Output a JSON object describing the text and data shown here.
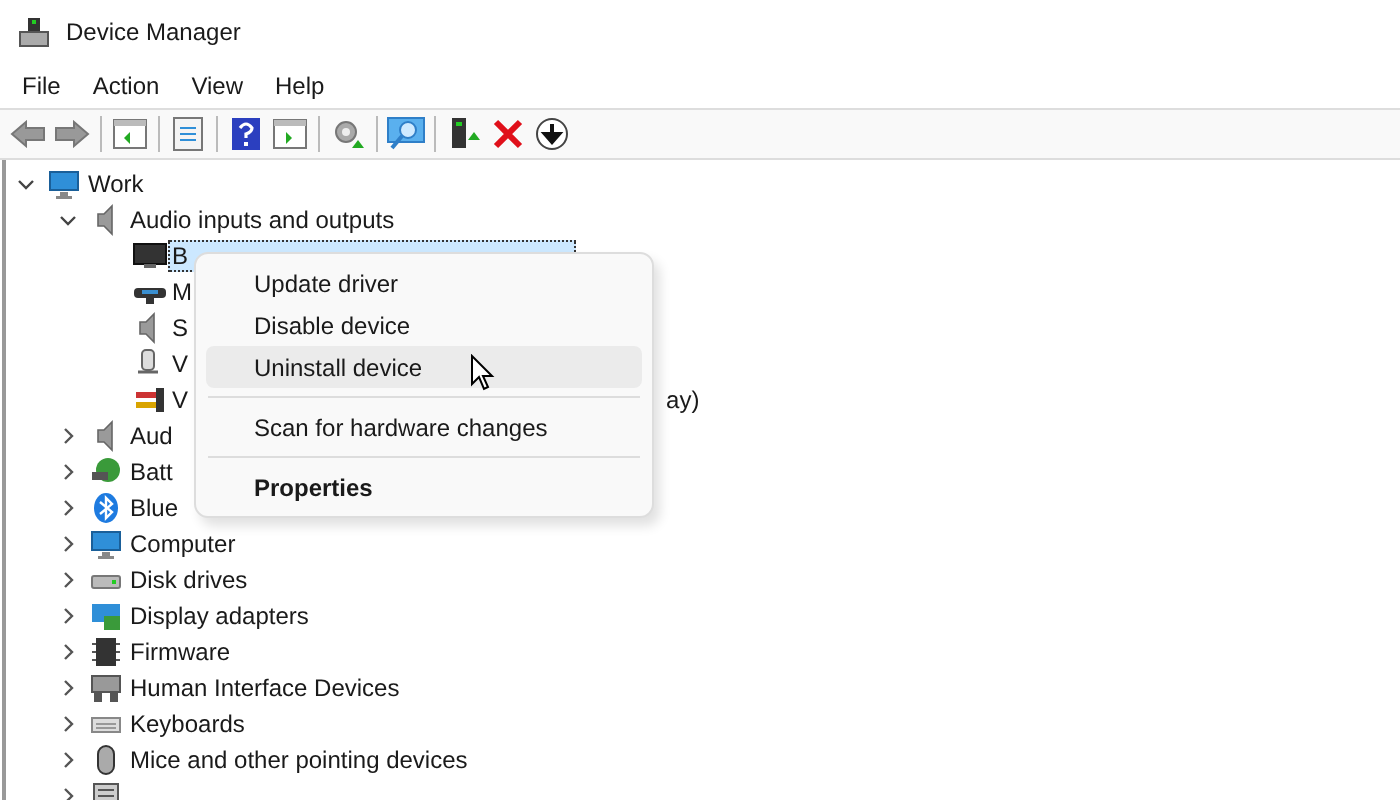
{
  "window": {
    "title": "Device Manager"
  },
  "menu_bar": [
    "File",
    "Action",
    "View",
    "Help"
  ],
  "tree": {
    "label": "Work",
    "expanded": true,
    "selected": false,
    "children": [
      {
        "label": "Audio inputs and outputs",
        "expanded": true,
        "selected": false,
        "children": [
          {
            "label": "B",
            "selected": true
          },
          {
            "label": "M",
            "selected": false
          },
          {
            "label": "S",
            "selected": false
          },
          {
            "label": "V",
            "selected": false
          },
          {
            "label": "V",
            "selected": false,
            "tail": "ay)"
          }
        ]
      },
      {
        "label": "Aud",
        "expanded": false,
        "selected": false
      },
      {
        "label": "Batt",
        "expanded": false,
        "selected": false
      },
      {
        "label": "Blue",
        "expanded": false,
        "selected": false
      },
      {
        "label": "Computer",
        "expanded": false,
        "selected": false
      },
      {
        "label": "Disk drives",
        "expanded": false,
        "selected": false
      },
      {
        "label": "Display adapters",
        "expanded": false,
        "selected": false
      },
      {
        "label": "Firmware",
        "expanded": false,
        "selected": false
      },
      {
        "label": "Human Interface Devices",
        "expanded": false,
        "selected": false
      },
      {
        "label": "Keyboards",
        "expanded": false,
        "selected": false
      },
      {
        "label": "Mice and other pointing devices",
        "expanded": false,
        "selected": false
      },
      {
        "expanded": false
      }
    ]
  },
  "context_menu": [
    {
      "kind": "item",
      "label": "Update driver",
      "hovered": false,
      "default": false
    },
    {
      "kind": "item",
      "label": "Disable device",
      "hovered": false,
      "default": false
    },
    {
      "kind": "item",
      "label": "Uninstall device",
      "hovered": true,
      "default": false
    },
    {
      "kind": "separator"
    },
    {
      "kind": "item",
      "label": "Scan for hardware changes",
      "hovered": false,
      "default": false
    },
    {
      "kind": "separator"
    },
    {
      "kind": "item",
      "label": "Properties",
      "hovered": false,
      "default": true
    }
  ]
}
